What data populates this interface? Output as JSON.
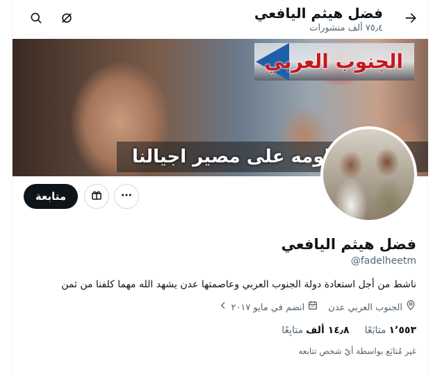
{
  "header": {
    "title": "فضل هيثم اليافعي",
    "posts_count": "٧٥٫٤ ألف منشورات"
  },
  "banner": {
    "headline": "الجنوب العربي",
    "caption": "نساومه على مصير اجيالنا"
  },
  "actions": {
    "follow_label": "متابعة"
  },
  "profile": {
    "name": "فضل هيثم اليافعي",
    "handle": "@fadelheetm",
    "bio": "ناشط من أجل استعادة دولة الجنوب العربي وعاصمتها عدن يشهد الله مهما كلفنا من ثمن",
    "location": "الجنوب العربي عدن",
    "joined": "انضم في مايو ٢٠١٧"
  },
  "stats": {
    "following_count": "١٬٥٥٣",
    "following_label": "متابَعًا",
    "followers_count": "١٤٫٨ ألف",
    "followers_label": "متابِعًا"
  },
  "notice": "غير مُتابَع بواسطة أيّ شخص تتابعه",
  "icons": {
    "back": "arrow-right-icon",
    "search": "search-icon",
    "hide": "eye-slash-icon",
    "gift": "gift-icon",
    "more": "more-icon",
    "location": "location-pin-icon",
    "calendar": "calendar-icon",
    "chevron": "chevron-left-icon"
  },
  "colors": {
    "primary_text": "#0f1419",
    "secondary_text": "#536471",
    "border": "#cfd9de",
    "follow_button": "#0f1419"
  }
}
